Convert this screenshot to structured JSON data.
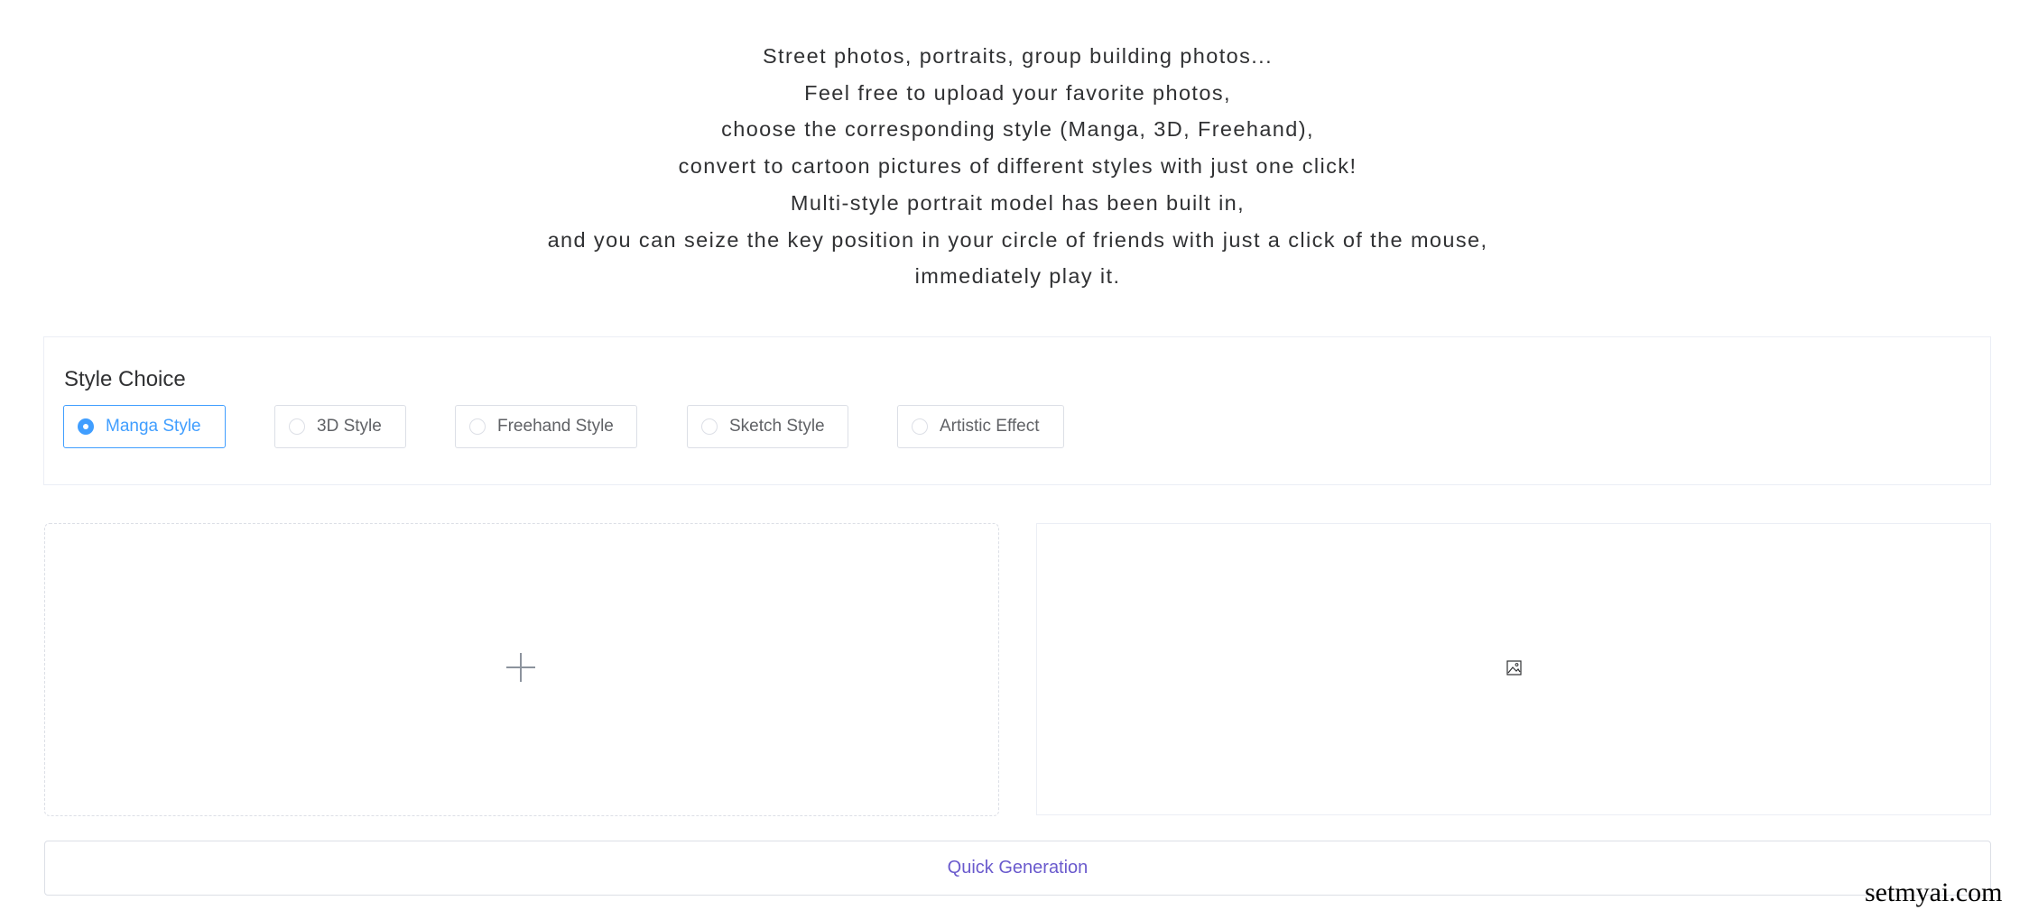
{
  "intro": {
    "lines": [
      "Street photos, portraits, group building photos...",
      "Feel free to upload your favorite photos,",
      "choose the corresponding style (Manga, 3D, Freehand),",
      "convert to cartoon pictures of different styles with just one click!",
      "Multi-style portrait model has been built in,",
      "and you can seize the key position in your circle of friends with just a click of the mouse,",
      "immediately play it."
    ]
  },
  "style_choice": {
    "title": "Style Choice",
    "selected": "Manga Style",
    "options": [
      {
        "label": "Manga Style",
        "checked": true
      },
      {
        "label": "3D Style",
        "checked": false
      },
      {
        "label": "Freehand Style",
        "checked": false
      },
      {
        "label": "Sketch Style",
        "checked": false
      },
      {
        "label": "Artistic Effect",
        "checked": false
      }
    ]
  },
  "upload": {
    "icon": "plus-icon"
  },
  "result": {
    "icon": "image-placeholder-icon"
  },
  "actions": {
    "generate_label": "Quick Generation"
  },
  "watermark": "setmyai.com",
  "colors": {
    "accent": "#409eff",
    "button_text": "#6a5acd",
    "border": "#dcdfe6",
    "text": "#303133"
  }
}
